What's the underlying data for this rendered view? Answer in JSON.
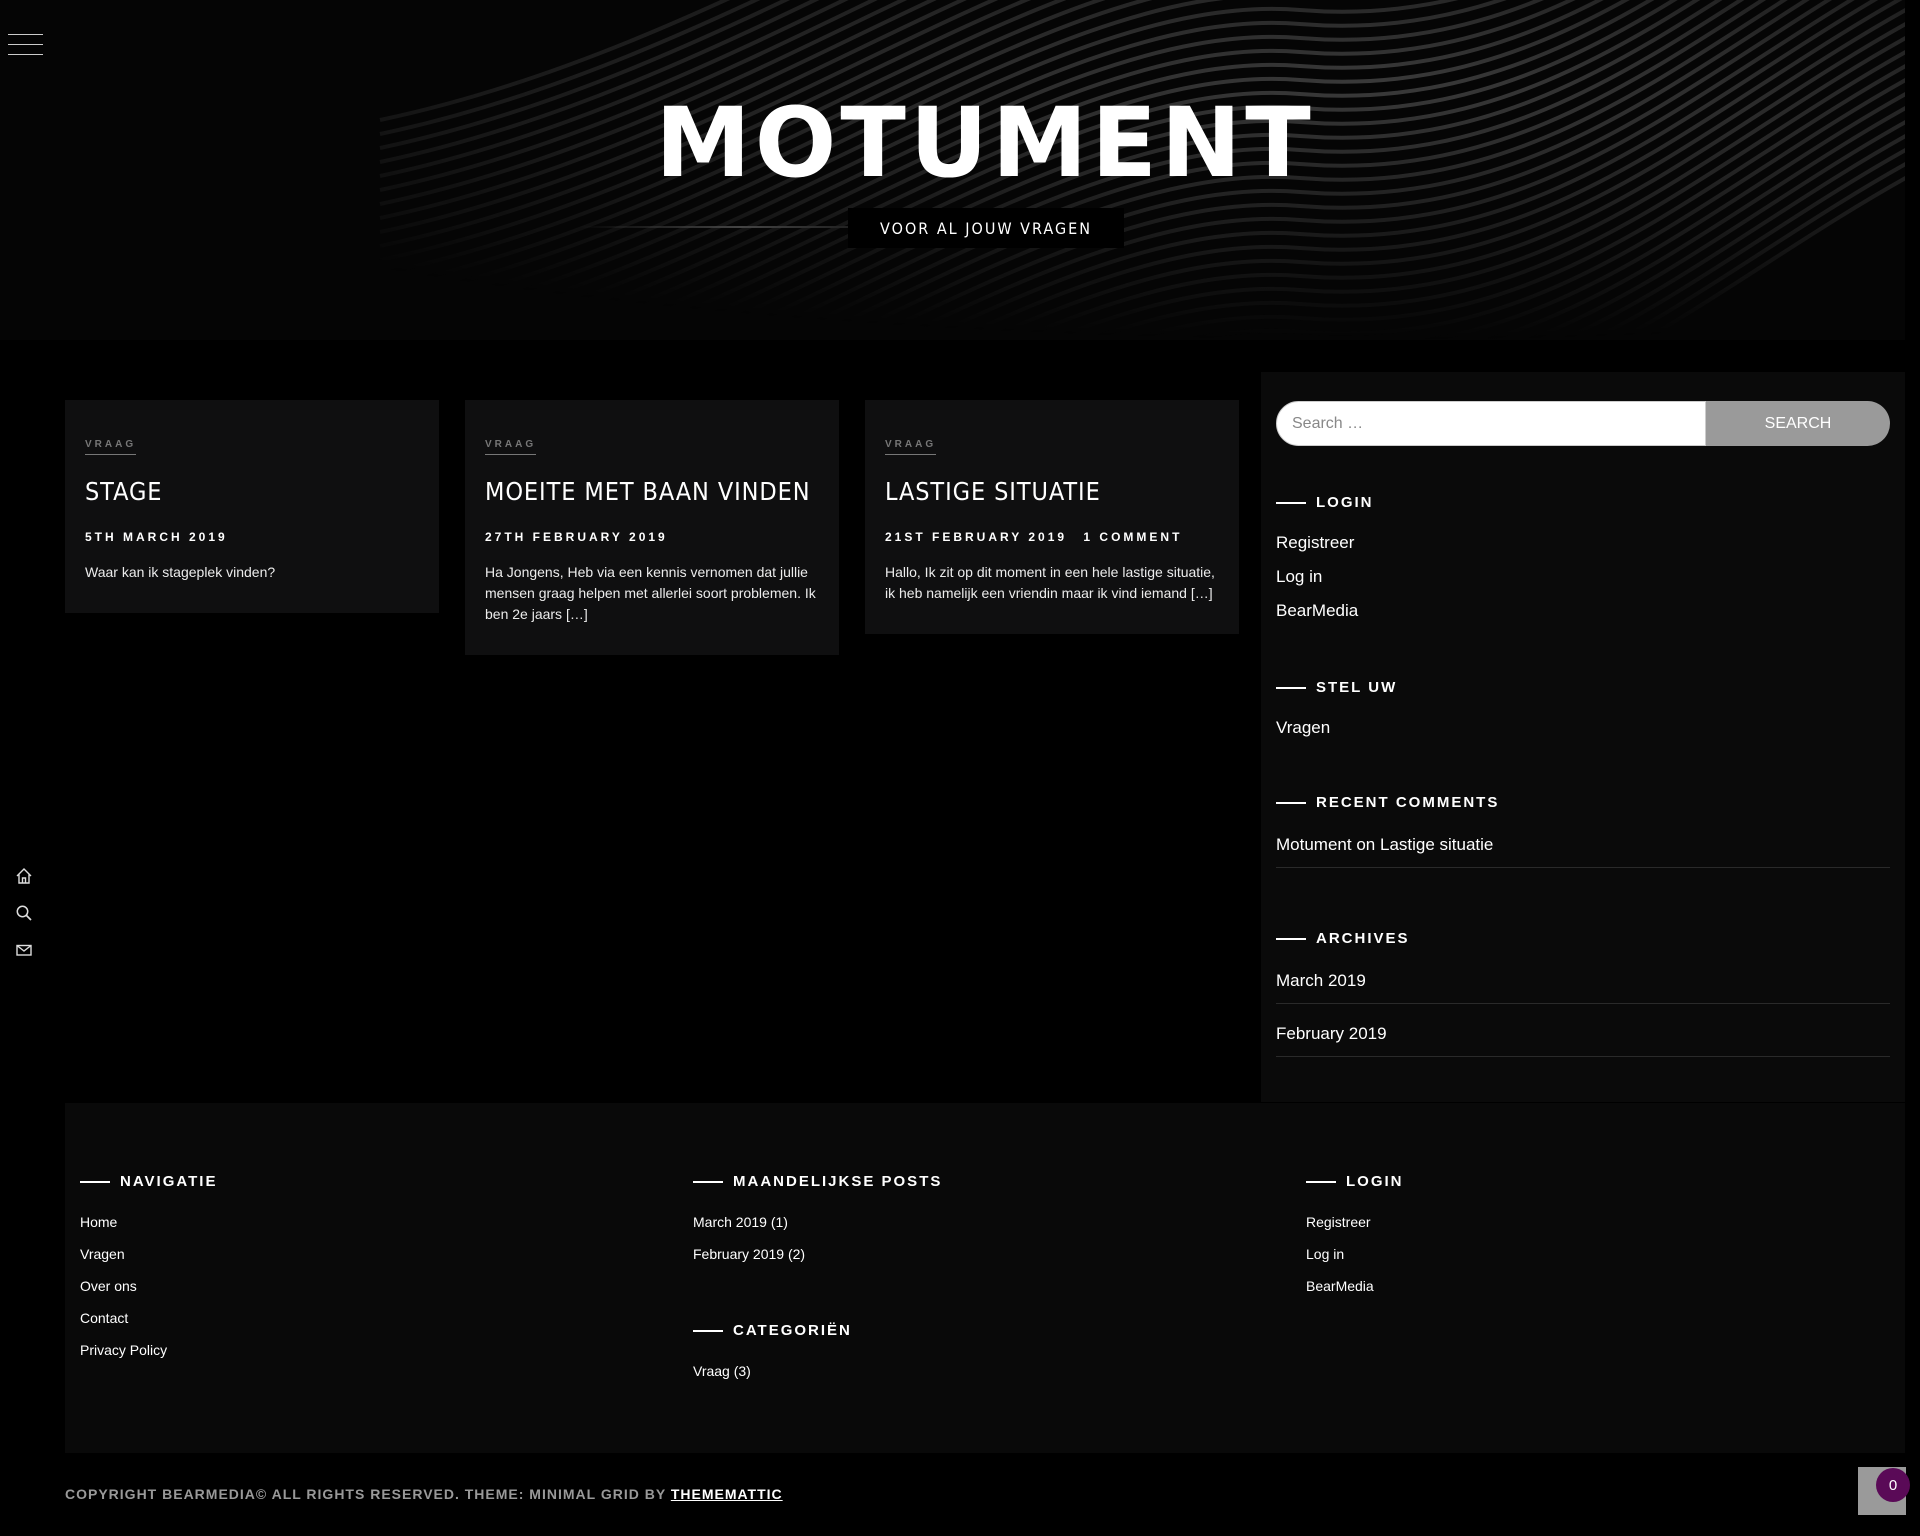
{
  "site": {
    "title": "MOTUMENT",
    "tagline": "VOOR AL JOUW VRAGEN"
  },
  "rail": {
    "icons": [
      "home-icon",
      "search-icon",
      "mail-icon"
    ]
  },
  "posts": [
    {
      "category": "VRAAG",
      "title": "STAGE",
      "date": "5TH MARCH 2019",
      "comments": "",
      "excerpt": "Waar kan ik stageplek vinden?"
    },
    {
      "category": "VRAAG",
      "title": "MOEITE MET BAAN VINDEN",
      "date": "27TH FEBRUARY 2019",
      "comments": "",
      "excerpt": "Ha Jongens, Heb via een kennis vernomen dat jullie mensen graag helpen met allerlei soort problemen. Ik ben 2e jaars […]"
    },
    {
      "category": "VRAAG",
      "title": "LASTIGE SITUATIE",
      "date": "21ST FEBRUARY 2019",
      "comments": "1 COMMENT",
      "excerpt": "Hallo, Ik zit op dit moment in een hele lastige situatie, ik heb namelijk een vriendin maar ik vind iemand […]"
    }
  ],
  "sidebar": {
    "search": {
      "placeholder": "Search …",
      "button": "SEARCH"
    },
    "login": {
      "title": "LOGIN",
      "links": [
        "Registreer",
        "Log in",
        "BearMedia"
      ]
    },
    "stel": {
      "title": "STEL UW",
      "links": [
        "Vragen"
      ]
    },
    "recent_comments": {
      "title": "RECENT COMMENTS",
      "author": "Motument",
      "on": "on",
      "post": "Lastige situatie"
    },
    "archives": {
      "title": "ARCHIVES",
      "links": [
        "March 2019",
        "February 2019"
      ]
    }
  },
  "footer": {
    "navigatie": {
      "title": "NAVIGATIE",
      "links": [
        "Home",
        "Vragen",
        "Over ons",
        "Contact",
        "Privacy Policy"
      ]
    },
    "maandelijkse": {
      "title": "MAANDELIJKSE POSTS",
      "links": [
        "March 2019 (1)",
        "February 2019 (2)"
      ]
    },
    "categorien": {
      "title": "CATEGORIËN",
      "links": [
        "Vraag (3)"
      ]
    },
    "login": {
      "title": "LOGIN",
      "links": [
        "Registreer",
        "Log in",
        "BearMedia"
      ]
    },
    "copyright": "COPYRIGHT BEARMEDIA© ALL RIGHTS RESERVED. THEME: MINIMAL GRID BY",
    "copyright_link": "THEMEMATTIC",
    "badge_count": "0"
  }
}
